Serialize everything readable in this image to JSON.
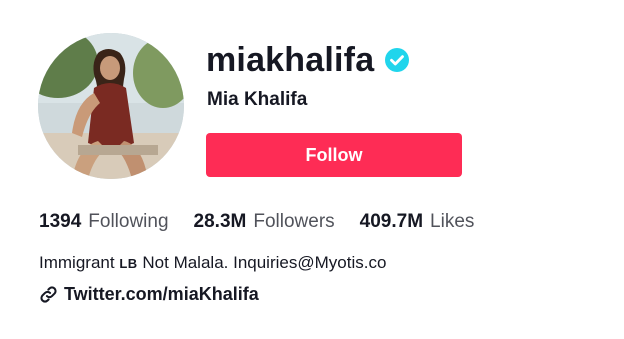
{
  "profile": {
    "username": "miakhalifa",
    "display_name": "Mia Khalifa",
    "verified_icon": "verified-badge-icon",
    "accent_color": "#fe2c55",
    "verified_color": "#20d5ec"
  },
  "actions": {
    "follow_label": "Follow"
  },
  "stats": {
    "following_count": "1394",
    "following_label": "Following",
    "followers_count": "28.3M",
    "followers_label": "Followers",
    "likes_count": "409.7M",
    "likes_label": "Likes"
  },
  "bio": {
    "part1": "Immigrant",
    "flag_code": "LB",
    "part2": "Not Malala. Inquiries@Myotis.co"
  },
  "link": {
    "icon": "link-icon",
    "text": "Twitter.com/miaKhalifa"
  }
}
